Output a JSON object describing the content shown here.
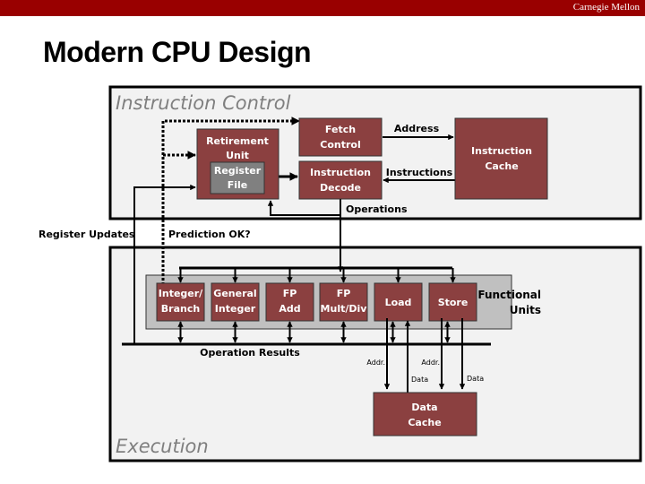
{
  "header": {
    "brand": "Carnegie Mellon"
  },
  "slide": {
    "title": "Modern CPU Design"
  },
  "colors": {
    "brand_bar": "#990000",
    "block_fill": "#8b4040",
    "register_file_fill": "#808080",
    "panel_fill": "#f2f2f2",
    "functional_units_fill": "#c0c0c0",
    "section_label": "#7f7f7f"
  },
  "instruction_control": {
    "label": "Instruction Control",
    "retirement_unit": [
      "Retirement",
      "Unit"
    ],
    "register_file": [
      "Register",
      "File"
    ],
    "fetch_control": [
      "Fetch",
      "Control"
    ],
    "instruction_decode": [
      "Instruction",
      "Decode"
    ],
    "instruction_cache": [
      "Instruction",
      "Cache"
    ],
    "address_label": "Address",
    "instructions_label": "Instructions",
    "operations_label": "Operations"
  },
  "between": {
    "register_updates": "Register Updates",
    "prediction_ok": "Prediction OK?"
  },
  "execution": {
    "label": "Execution",
    "functional_units_label": [
      "Functional",
      "Units"
    ],
    "units": [
      {
        "name": "integer-branch",
        "lines": [
          "Integer/",
          "Branch"
        ]
      },
      {
        "name": "general-integer",
        "lines": [
          "General",
          "Integer"
        ]
      },
      {
        "name": "fp-add",
        "lines": [
          "FP",
          "Add"
        ]
      },
      {
        "name": "fp-mult-div",
        "lines": [
          "FP",
          "Mult/Div"
        ]
      },
      {
        "name": "load",
        "lines": [
          "Load"
        ]
      },
      {
        "name": "store",
        "lines": [
          "Store"
        ]
      }
    ],
    "operation_results": "Operation Results",
    "data_cache": [
      "Data",
      "Cache"
    ],
    "addr_label": "Addr.",
    "data_label": "Data"
  }
}
